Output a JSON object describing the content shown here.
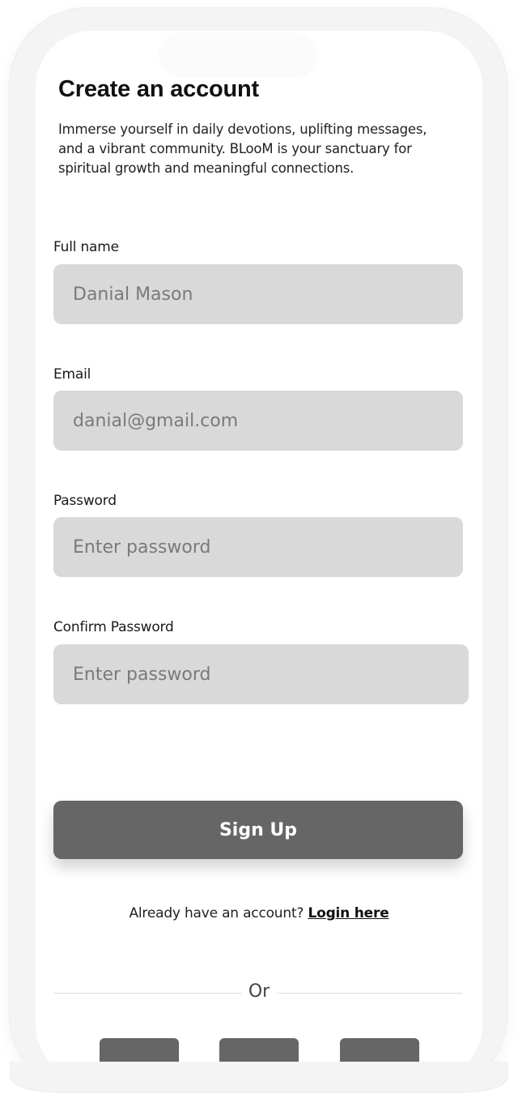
{
  "signup": {
    "title": "Create an account",
    "subtitle": "Immerse yourself in daily devotions, uplifting messages, and a vibrant community. BLooM is your sanctuary for spiritual growth and meaningful connections.",
    "fields": [
      {
        "label": "Full name",
        "placeholder": "Danial Mason"
      },
      {
        "label": "Email",
        "placeholder": "danial@gmail.com"
      },
      {
        "label": "Password",
        "placeholder": "Enter password"
      },
      {
        "label": "Confirm Password",
        "placeholder": "Enter password"
      }
    ],
    "button_label": "Sign Up",
    "login_prompt": "Already have an account?",
    "login_link": "Login here",
    "divider_label": "Or"
  },
  "colors": {
    "input_bg": "#d9d9d9",
    "button_bg": "#666666",
    "placeholder": "#7a7a7a"
  }
}
